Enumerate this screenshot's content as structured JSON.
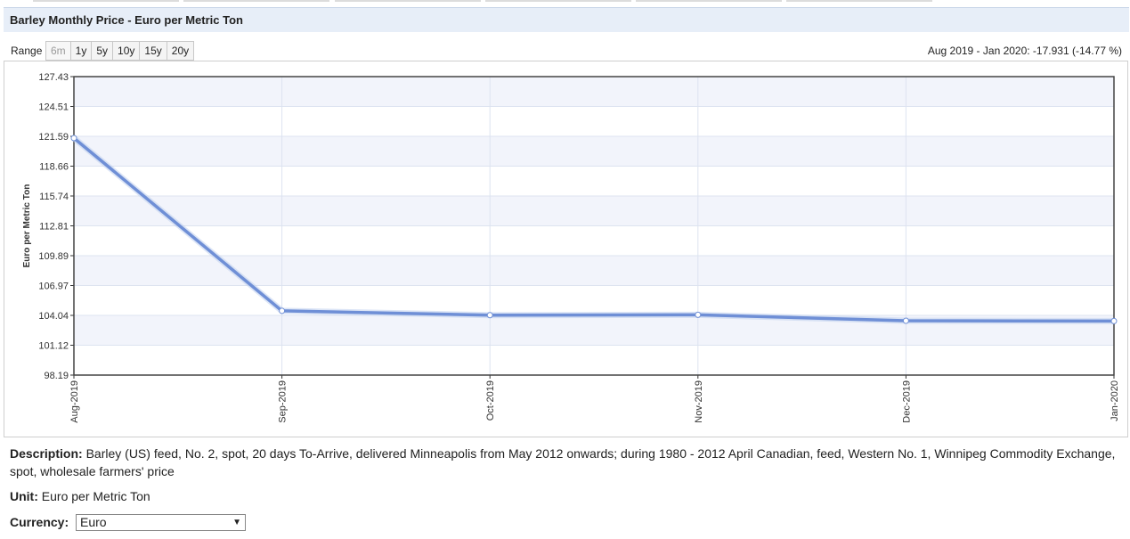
{
  "header": {
    "title": "Barley Monthly Price - Euro per Metric Ton"
  },
  "range": {
    "label": "Range",
    "buttons": [
      "6m",
      "1y",
      "5y",
      "10y",
      "15y",
      "20y"
    ],
    "active": "6m"
  },
  "change_summary": "Aug 2019 - Jan 2020: -17.931 (-14.77 %)",
  "chart_data": {
    "type": "line",
    "title": "",
    "xlabel": "",
    "ylabel": "Euro per Metric Ton",
    "categories": [
      "Aug-2019",
      "Sep-2019",
      "Oct-2019",
      "Nov-2019",
      "Dec-2019",
      "Jan-2020"
    ],
    "series": [
      {
        "values": [
          121.41,
          104.48,
          104.06,
          104.09,
          103.51,
          103.48
        ]
      }
    ],
    "ylim": [
      98.19,
      127.43
    ],
    "yticks": [
      "127.43",
      "124.51",
      "121.59",
      "118.66",
      "115.74",
      "112.81",
      "109.89",
      "106.97",
      "104.04",
      "101.12",
      "98.19"
    ],
    "grid": true,
    "line_color": "#6f8fd6"
  },
  "description": {
    "label": "Description:",
    "text": "Barley (US) feed, No. 2, spot, 20 days To-Arrive, delivered Minneapolis from May 2012 onwards; during 1980 - 2012 April Canadian, feed, Western No. 1, Winnipeg Commodity Exchange, spot, wholesale farmers' price"
  },
  "unit": {
    "label": "Unit:",
    "value": "Euro per Metric Ton"
  },
  "currency": {
    "label": "Currency:",
    "selected": "Euro"
  }
}
